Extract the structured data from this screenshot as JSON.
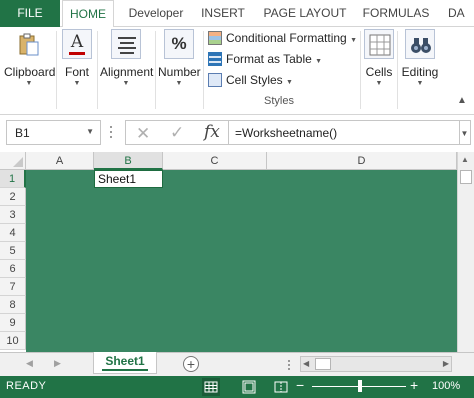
{
  "ribbon_tabs": {
    "file": "FILE",
    "home": "HOME",
    "developer": "Developer",
    "insert": "INSERT",
    "page_layout": "PAGE LAYOUT",
    "formulas": "FORMULAS",
    "data": "DA"
  },
  "ribbon": {
    "clipboard": "Clipboard",
    "font": "Font",
    "alignment": "Alignment",
    "number": "Number",
    "number_symbol": "%",
    "font_symbol": "A",
    "conditional_formatting": "Conditional Formatting",
    "format_as_table": "Format as Table",
    "cell_styles": "Cell Styles",
    "styles_group": "Styles",
    "cells": "Cells",
    "editing": "Editing"
  },
  "formula_bar": {
    "name_box": "B1",
    "fx": "fx",
    "cancel": "✕",
    "enter": "✓",
    "formula": "=Worksheetname()"
  },
  "columns": [
    "A",
    "B",
    "C",
    "D"
  ],
  "rows": [
    "1",
    "2",
    "3",
    "4",
    "5",
    "6",
    "7",
    "8",
    "9",
    "10"
  ],
  "selected_cell": {
    "ref": "B1",
    "value": "Sheet1"
  },
  "sheets": {
    "active": "Sheet1",
    "add": "+"
  },
  "status": {
    "ready": "READY",
    "zoom": "100%",
    "zoom_minus": "−",
    "zoom_plus": "+"
  },
  "colors": {
    "accent": "#217346",
    "sheet_fill": "#3a8663"
  }
}
